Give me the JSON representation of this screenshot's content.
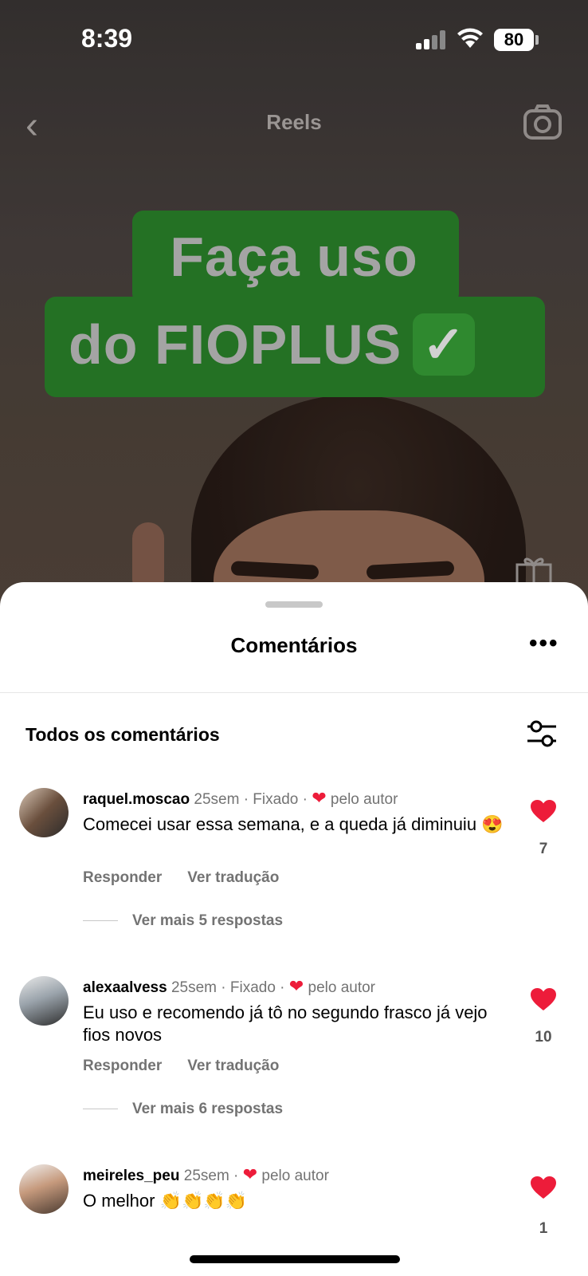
{
  "status_bar": {
    "time": "8:39",
    "battery": "80"
  },
  "header": {
    "title": "Reels"
  },
  "video": {
    "overlay_line1": "Faça uso",
    "overlay_line2": "do FIOPLUS",
    "overlay_emoji": "✓"
  },
  "sheet": {
    "title": "Comentários",
    "more": "•••",
    "filter_label": "Todos os comentários"
  },
  "comments": [
    {
      "username": "raquel.moscao",
      "meta": " 25sem · Fixado · ",
      "heart": "❤",
      "by_author": " pelo autor",
      "text": "Comecei usar essa semana, e a queda já diminuiu 😍",
      "reply": "Responder",
      "translate": "Ver tradução",
      "more_replies": "Ver mais 5 respostas",
      "likes": "7"
    },
    {
      "username": "alexaalvess",
      "meta": " 25sem · Fixado · ",
      "heart": "❤",
      "by_author": " pelo autor",
      "text": "Eu uso e recomendo  já tô no segundo frasco já vejo fios novos",
      "reply": "Responder",
      "translate": "Ver tradução",
      "more_replies": "Ver mais 6 respostas",
      "likes": "10"
    },
    {
      "username": "meireles_peu",
      "meta": " 25sem · ",
      "heart": "❤",
      "by_author": " pelo autor",
      "text": "O melhor 👏👏👏👏",
      "likes": "1"
    }
  ],
  "colors": {
    "accent_green": "#2d8a2d",
    "like_red": "#ed1c3a"
  }
}
